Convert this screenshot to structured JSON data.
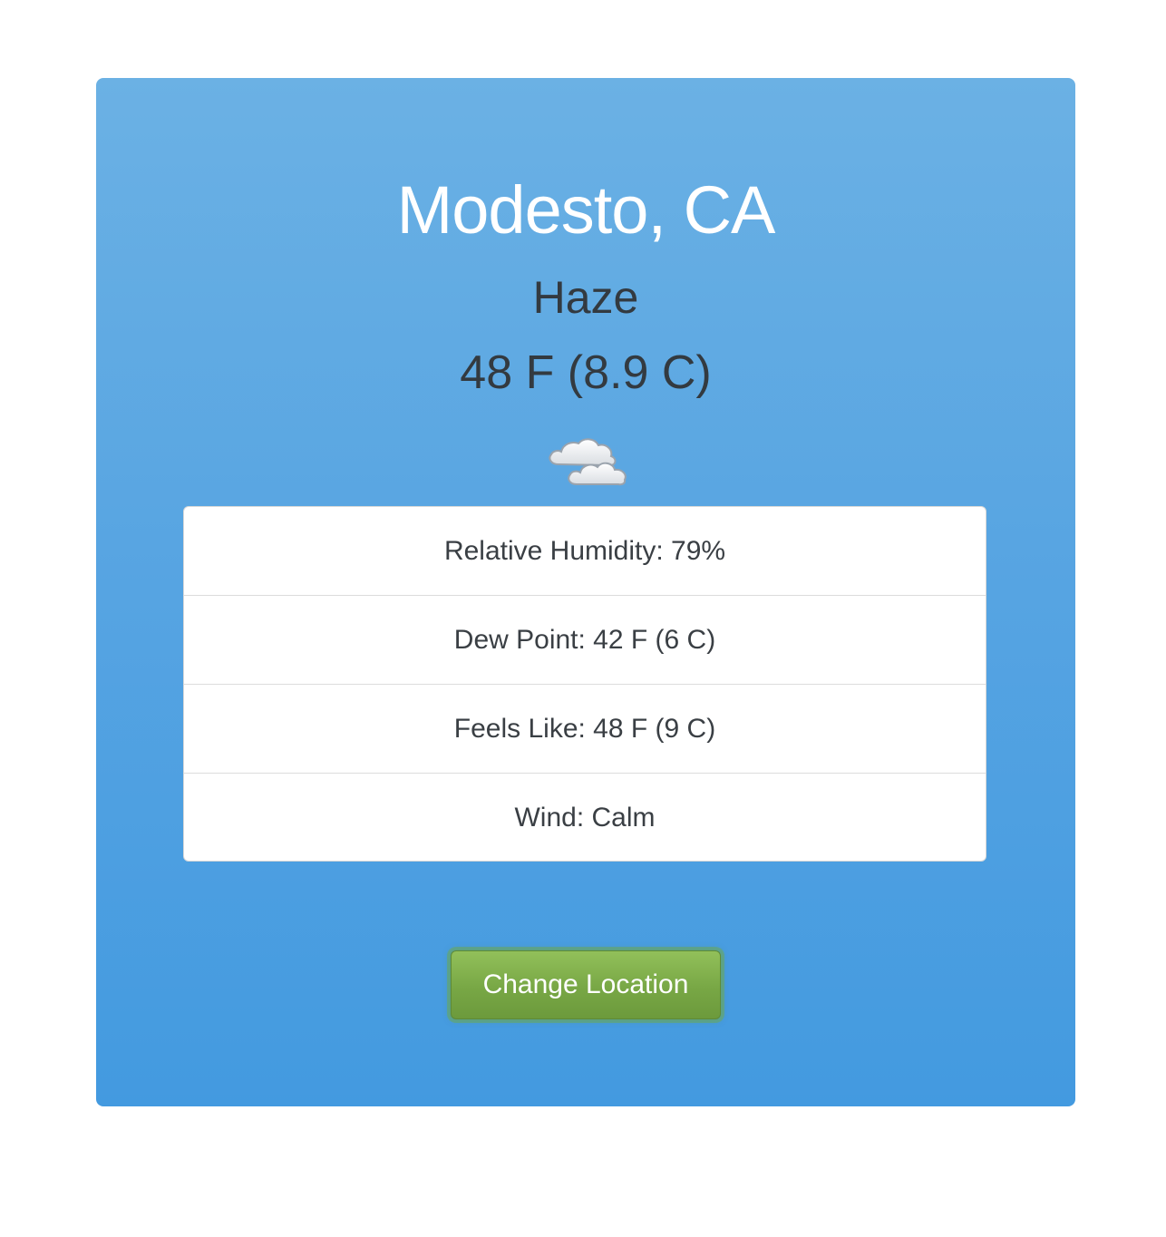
{
  "weather": {
    "location": "Modesto, CA",
    "condition": "Haze",
    "temperature": "48 F (8.9 C)",
    "icon": "cloud-icon",
    "details": [
      {
        "label": "Relative Humidity: 79%"
      },
      {
        "label": "Dew Point: 42 F (6 C)"
      },
      {
        "label": "Feels Like: 48 F (9 C)"
      },
      {
        "label": "Wind: Calm"
      }
    ]
  },
  "actions": {
    "change_location_label": "Change Location"
  },
  "colors": {
    "card_top": "#6bb1e4",
    "card_bottom": "#439ae0",
    "button_green": "#78a745",
    "text_dark": "#333a40"
  }
}
